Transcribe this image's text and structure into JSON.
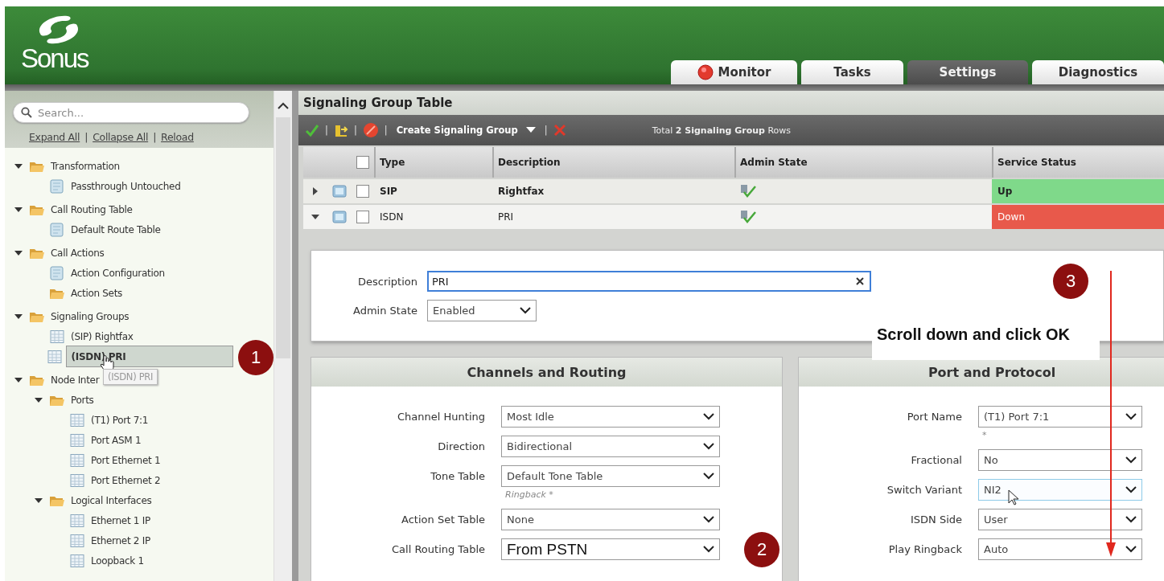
{
  "header": {
    "logo": "Sonus",
    "tabs": [
      {
        "label": "Monitor",
        "kind": "status",
        "selected": false
      },
      {
        "label": "Tasks",
        "kind": "plain",
        "selected": false
      },
      {
        "label": "Settings",
        "kind": "plain",
        "selected": true
      },
      {
        "label": "Diagnostics",
        "kind": "plain",
        "selected": false
      }
    ]
  },
  "sidebar": {
    "search": {
      "placeholder": "Search..."
    },
    "links": [
      {
        "kind": "link",
        "text": "Expand All"
      },
      {
        "kind": "separator",
        "text": "|"
      },
      {
        "kind": "link",
        "text": "Collapse All"
      },
      {
        "kind": "separator",
        "text": "|"
      },
      {
        "kind": "link",
        "text": "Reload"
      }
    ],
    "tree": [
      {
        "label": "Transformation",
        "kind": "folder",
        "expanded": true,
        "selected": false,
        "children": [
          {
            "label": "Passthrough Untouched",
            "kind": "document",
            "selected": false
          }
        ]
      },
      {
        "label": "Call Routing Table",
        "kind": "folder",
        "expanded": true,
        "selected": false,
        "children": [
          {
            "label": "Default Route Table",
            "kind": "document",
            "selected": false
          }
        ]
      },
      {
        "label": "Call Actions",
        "kind": "folder",
        "expanded": true,
        "selected": false,
        "children": [
          {
            "label": "Action Configuration",
            "kind": "document",
            "selected": false
          },
          {
            "label": "Action Sets",
            "kind": "folder",
            "selected": false
          }
        ]
      },
      {
        "label": "Signaling Groups",
        "kind": "folder",
        "expanded": true,
        "selected": false,
        "children": [
          {
            "label": "(SIP) Rightfax",
            "kind": "table",
            "selected": false
          },
          {
            "label": "(ISDN) PRI",
            "kind": "table",
            "selected": true,
            "badge": "1",
            "tooltip": "(ISDN) PRI"
          }
        ]
      },
      {
        "label": "Node Inter",
        "kind": "folder",
        "expanded": true,
        "selected": false,
        "children": [
          {
            "label": "Ports",
            "kind": "folder",
            "expanded": true,
            "selected": false,
            "children": [
              {
                "label": "(T1) Port 7:1",
                "kind": "table",
                "selected": false
              },
              {
                "label": "Port ASM 1",
                "kind": "table",
                "selected": false
              },
              {
                "label": "Port Ethernet 1",
                "kind": "table",
                "selected": false
              },
              {
                "label": "Port Ethernet 2",
                "kind": "table",
                "selected": false
              }
            ]
          },
          {
            "label": "Logical Interfaces",
            "kind": "folder",
            "expanded": true,
            "selected": false,
            "children": [
              {
                "label": "Ethernet 1 IP",
                "kind": "table",
                "selected": false
              },
              {
                "label": "Ethernet 2 IP",
                "kind": "table",
                "selected": false
              },
              {
                "label": "Loopback 1",
                "kind": "table",
                "selected": false
              }
            ]
          }
        ]
      }
    ]
  },
  "table": {
    "title": "Signaling Group Table",
    "toolbar": [
      {
        "kind": "apply"
      },
      {
        "kind": "separator",
        "text": "|"
      },
      {
        "kind": "import"
      },
      {
        "kind": "separator",
        "text": "|"
      },
      {
        "kind": "disable"
      },
      {
        "kind": "separator",
        "text": "|"
      },
      {
        "kind": "dropdown",
        "text": "Create Signaling Group"
      },
      {
        "kind": "separator",
        "text": "|"
      },
      {
        "kind": "delete"
      }
    ],
    "summary": "Total **2 Signaling Group** Rows",
    "select_all_checked": false,
    "columns": [
      "Type",
      "Description",
      "Admin State",
      "Service Status"
    ],
    "rows": [
      {
        "type": "SIP",
        "description": "Rightfax",
        "emphasized": true,
        "expanded": false,
        "checked": false,
        "status": "Up",
        "color": "#7fd98a"
      },
      {
        "type": "ISDN",
        "description": "PRI",
        "emphasized": false,
        "expanded": true,
        "checked": false,
        "status": "Down",
        "color": "#e8594b"
      }
    ]
  },
  "detail": {
    "general": {
      "badge": "3",
      "fields": [
        {
          "label": "Description",
          "value": "PRI",
          "kind": "text"
        },
        {
          "label": "Admin State",
          "value": "Enabled",
          "kind": "select"
        }
      ]
    },
    "callout": "Scroll down and click OK",
    "panels": [
      {
        "title": "Channels and Routing",
        "fields": [
          {
            "label": "Channel Hunting",
            "value": "Most Idle",
            "focused": false,
            "emphasized": false
          },
          {
            "label": "Direction",
            "value": "Bidirectional",
            "focused": false,
            "emphasized": false
          },
          {
            "label": "Tone Table",
            "value": "Default Tone Table",
            "hint": "Ringback *",
            "focused": false,
            "emphasized": false
          },
          {
            "label": "Action Set Table",
            "value": "None",
            "focused": false,
            "emphasized": false
          },
          {
            "label": "Call Routing Table",
            "value": "From PSTN",
            "focused": false,
            "emphasized": true,
            "badge": "2"
          }
        ]
      },
      {
        "title": "Port and Protocol",
        "fields": [
          {
            "label": "Port Name",
            "value": "(T1) Port 7:1",
            "hint": "*",
            "focused": false,
            "emphasized": false
          },
          {
            "label": "Fractional",
            "value": "No",
            "focused": false,
            "emphasized": false
          },
          {
            "label": "Switch Variant",
            "value": "NI2",
            "focused": true,
            "emphasized": false,
            "cursor": true
          },
          {
            "label": "ISDN Side",
            "value": "User",
            "focused": false,
            "emphasized": false
          },
          {
            "label": "Play Ringback",
            "value": "Auto",
            "focused": false,
            "emphasized": false
          }
        ]
      }
    ]
  }
}
